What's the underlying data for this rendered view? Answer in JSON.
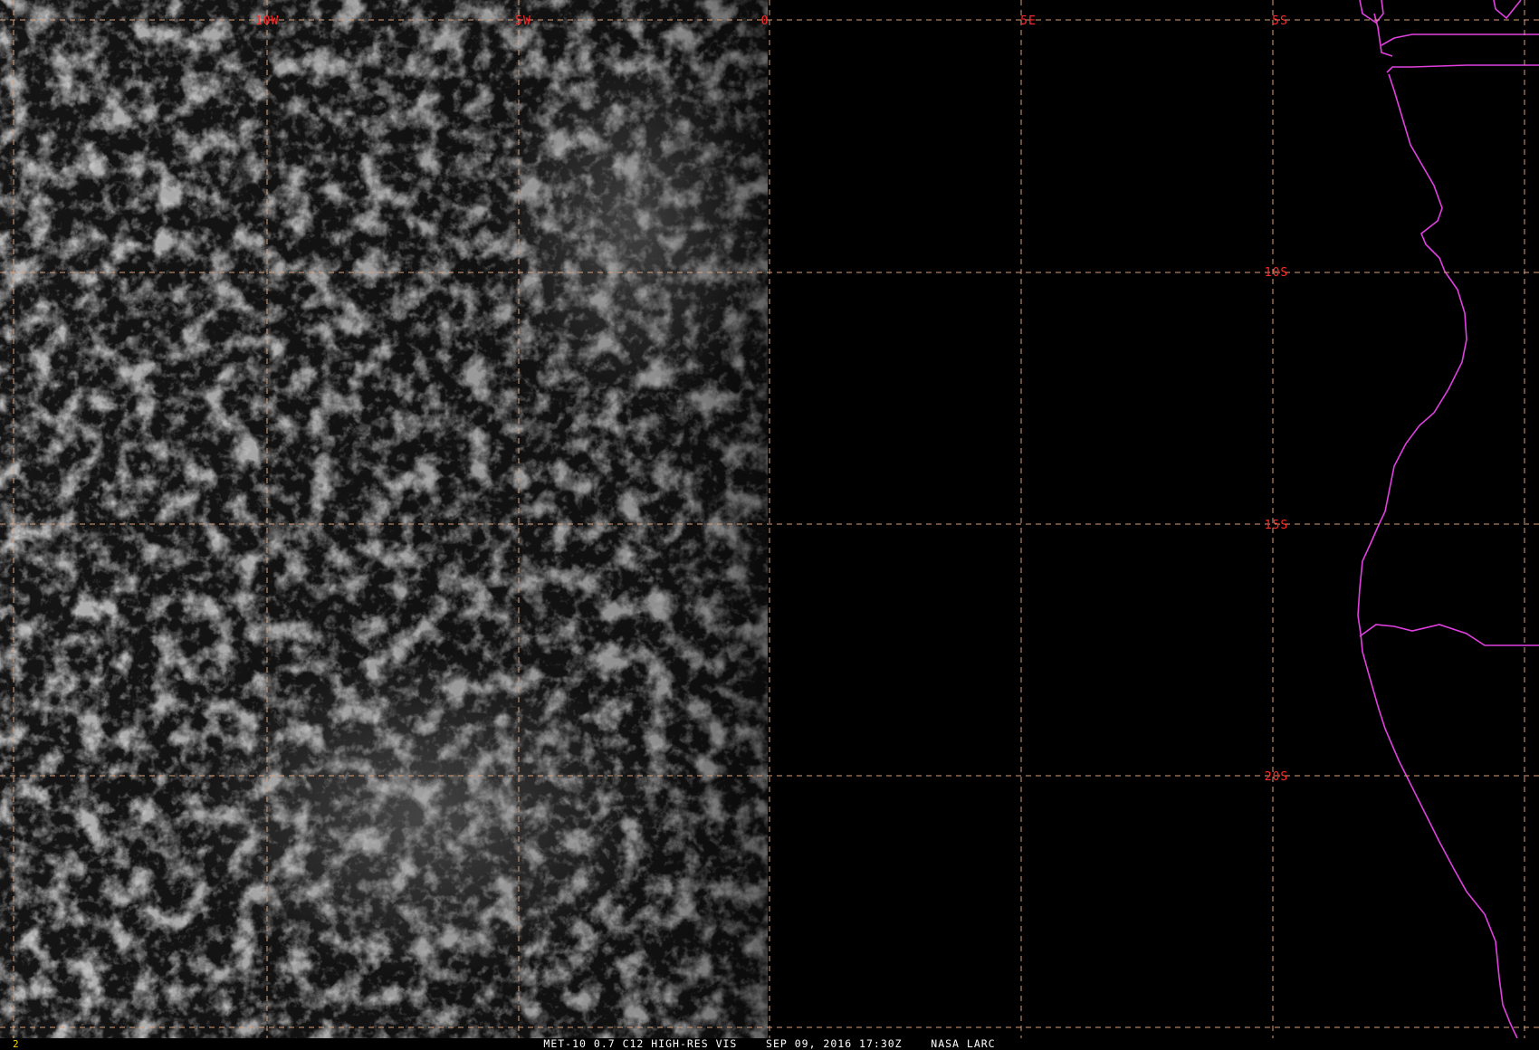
{
  "image": {
    "caption": "MET-10 0.7 C12 HIGH-RES VIS    SEP 09, 2016 17:30Z    NASA LARC",
    "frame_number": "2"
  },
  "grid": {
    "longitude_labels": [
      "10W",
      "5W",
      "0",
      "5E"
    ],
    "latitude_labels": [
      "5S",
      "10S",
      "15S",
      "20S"
    ]
  },
  "colors": {
    "background": "#000000",
    "grid_line": "#d9a07a",
    "grid_label": "#ff2a2a",
    "coastline": "#e040e0",
    "caption": "#ffffff",
    "frame_number": "#ffd400",
    "cloud": "#cfcfcf"
  }
}
